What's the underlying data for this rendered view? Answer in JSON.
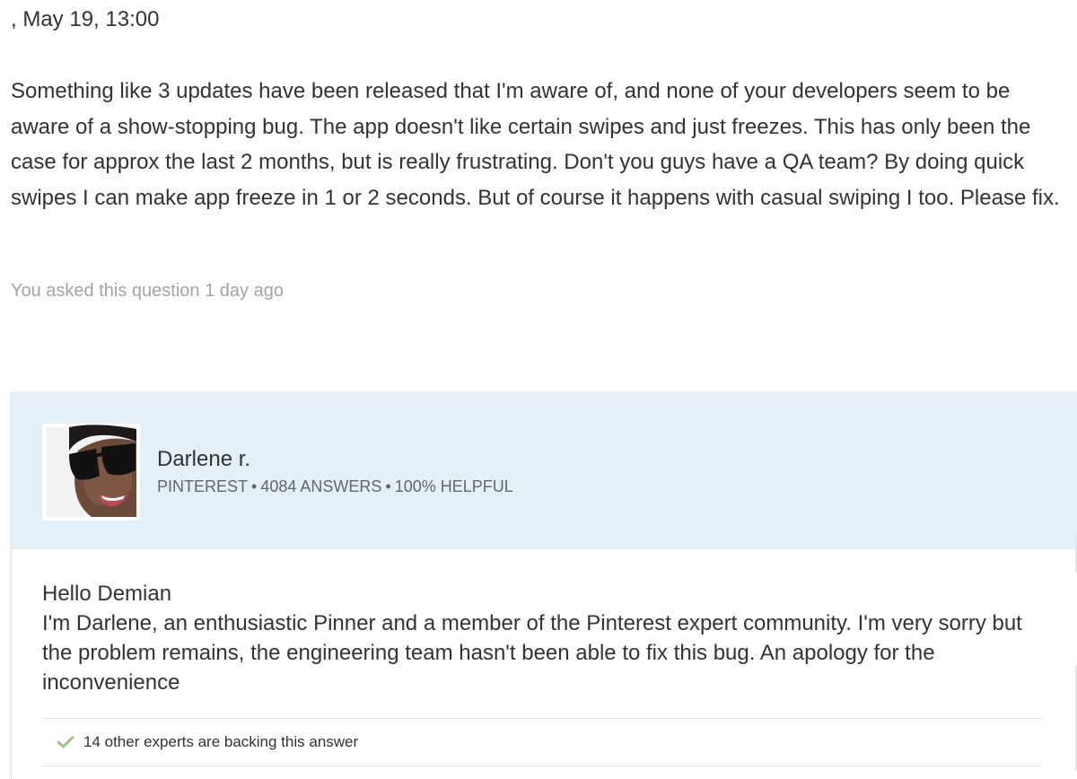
{
  "question": {
    "meta": ", May 19, 13:00",
    "body": "Something like 3 updates have been released that I'm aware of, and none of your developers seem to be aware of a show-stopping bug. The app doesn't like certain swipes and just freezes. This has only been the case for approx the last 2 months, but is really frustrating. Don't you guys have a QA team? By doing quick swipes I can make app freeze in 1 or 2 seconds. But of course it happens with casual swiping I too. Please fix.",
    "footer": "You asked this question 1 day ago"
  },
  "answer": {
    "expert": {
      "name": "Darlene r.",
      "company": "PINTEREST",
      "answers": "4084 ANSWERS",
      "helpful": "100% HELPFUL",
      "separator": "•"
    },
    "greeting": "Hello Demian",
    "body": "I'm Darlene, an enthusiastic Pinner and a member of the Pinterest expert community. I'm very sorry but the problem remains, the engineering team hasn't been able to fix this bug. An apology for the inconvenience",
    "backing": "14 other experts are backing this answer"
  },
  "icons": {
    "backing": "checkmark-icon",
    "avatar": "expert-avatar-photo"
  },
  "colors": {
    "header_background": "#e3f0f7",
    "muted_text": "#a3a3a3",
    "check_green": "#9bc28a"
  }
}
